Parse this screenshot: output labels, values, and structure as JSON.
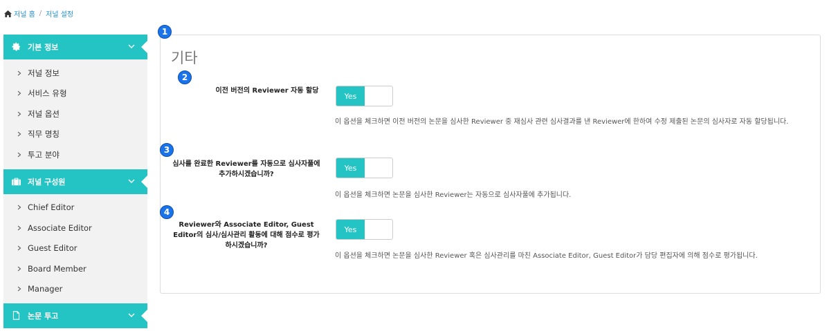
{
  "breadcrumb": {
    "home": "저널 홈",
    "separator": "/",
    "current": "저널 설정"
  },
  "sidebar": {
    "sections": [
      {
        "title": "기본 정보",
        "icon": "gear-icon",
        "items": [
          "저널 정보",
          "서비스 유형",
          "저널 옵션",
          "직무 명칭",
          "투고 분야"
        ]
      },
      {
        "title": "저널 구성원",
        "icon": "briefcase-icon",
        "items": [
          "Chief Editor",
          "Associate Editor",
          "Guest Editor",
          "Board Member",
          "Manager"
        ]
      },
      {
        "title": "논문 투고",
        "icon": "document-icon",
        "items": []
      }
    ]
  },
  "panel": {
    "title": "기타",
    "options": [
      {
        "label": "이전 버전의 Reviewer 자동 할당",
        "toggle": "Yes",
        "description": "이 옵션을 체크하면 이전 버전의 논문을 심사한 Reviewer 중 재심사 관련 심사결과를 낸 Reviewer에 한하여 수정 제출된 논문의 심사자로 자동 할당됩니다."
      },
      {
        "label": "심사를 완료한 Reviewer를 자동으로 심사자풀에 추가하시겠습니까?",
        "toggle": "Yes",
        "description": "이 옵션을 체크하면 논문을 심사한 Reviewer는 자동으로 심사자풀에 추가됩니다."
      },
      {
        "label": "Reviewer와 Associate Editor, Guest Editor의 심사/심사관리 활동에 대해 점수로 평가하시겠습니까?",
        "toggle": "Yes",
        "description": "이 옵션을 체크하면 논문을 심사한 Reviewer 혹은 심사관리를 마친 Associate Editor, Guest Editor가 담당 편집자에 의해 점수로 평가됩니다."
      }
    ]
  },
  "markers": [
    "1",
    "2",
    "3",
    "4"
  ],
  "colors": {
    "accent": "#25c4c4",
    "link": "#1f8fcf",
    "marker": "#1a73e8"
  }
}
